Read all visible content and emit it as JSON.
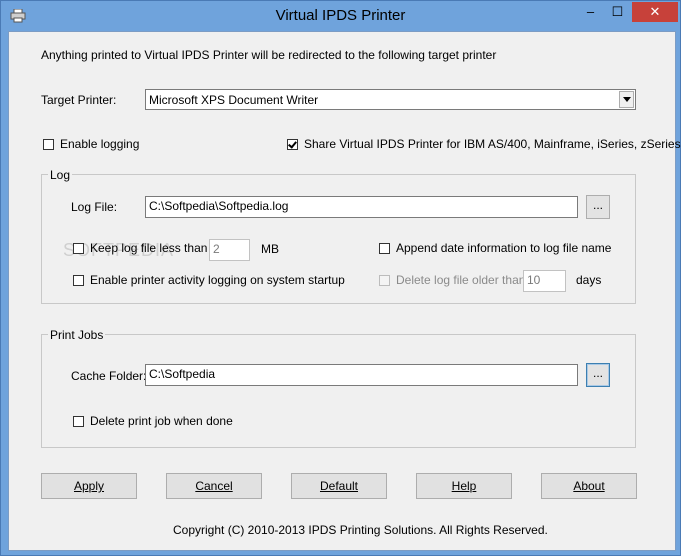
{
  "window": {
    "title": "Virtual IPDS Printer",
    "minimize": "–",
    "maximize": "☐",
    "close": "✕"
  },
  "intro_text": "Anything printed to Virtual IPDS Printer will be redirected to the following target printer",
  "target_printer": {
    "label": "Target Printer:",
    "value": "Microsoft XPS Document Writer"
  },
  "enable_logging": {
    "label": "Enable logging",
    "checked": false
  },
  "share": {
    "label": "Share Virtual IPDS Printer for IBM AS/400, Mainframe, iSeries, zSeries",
    "checked": true
  },
  "log": {
    "group_title": "Log",
    "file_label": "Log File:",
    "file_value": "C:\\Softpedia\\Softpedia.log",
    "browse": "...",
    "keep_label": "Keep log file less than",
    "keep_value": "2",
    "keep_unit": "MB",
    "append_label": "Append date information to log file name",
    "startup_label": "Enable printer activity logging on system startup",
    "delete_label": "Delete log file older than",
    "delete_value": "10",
    "delete_unit": "days"
  },
  "print_jobs": {
    "group_title": "Print Jobs",
    "cache_label": "Cache Folder:",
    "cache_value": "C:\\Softpedia",
    "browse": "...",
    "delete_label": "Delete print job when done"
  },
  "buttons": {
    "apply": "Apply",
    "cancel": "Cancel",
    "default": "Default",
    "help": "Help",
    "about": "About"
  },
  "copyright": "Copyright (C) 2010-2013 IPDS Printing Solutions.  All Rights Reserved.",
  "watermark": "SOFTPEDIA"
}
